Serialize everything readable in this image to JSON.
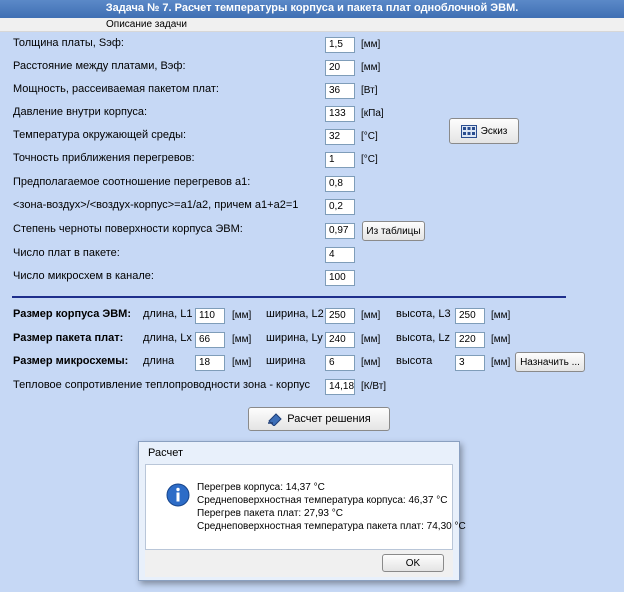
{
  "window": {
    "title": "Задача № 7. Расчет температуры корпуса и пакета плат одноблочной ЭВМ."
  },
  "menu": {
    "items": [
      "Описание задачи"
    ]
  },
  "params": [
    {
      "label": "Толщина платы, Sэф:",
      "value": "1,5",
      "unit": "[мм]"
    },
    {
      "label": "Расстояние между платами, Вэф:",
      "value": "20",
      "unit": "[мм]"
    },
    {
      "label": "Мощность, рассеиваемая пакетом плат:",
      "value": "36",
      "unit": "[Вт]"
    },
    {
      "label": "Давление внутри корпуса:",
      "value": "133",
      "unit": "[кПа]"
    },
    {
      "label": "Температура окружающей среды:",
      "value": "32",
      "unit": "[°С]"
    },
    {
      "label": "Точность приближения перегревов:",
      "value": "1",
      "unit": "[°С]"
    },
    {
      "label": "Предполагаемое соотношение перегревов   а1:",
      "value": "0,8",
      "unit": ""
    },
    {
      "label": "<зона-воздух>/<воздух-корпус>=а1/а2, причем а1+а2=1",
      "value": "0,2",
      "unit": ""
    },
    {
      "label": "Степень черноты поверхности корпуса ЭВМ:",
      "value": "0,97",
      "unit": ""
    },
    {
      "label": "Число плат в пакете:",
      "value": "4",
      "unit": ""
    },
    {
      "label": "Число микросхем в канале:",
      "value": "100",
      "unit": ""
    }
  ],
  "buttons": {
    "sketch": "Эскиз",
    "from_table": "Из таблицы",
    "assign": "Назначить ...",
    "calculate": "Расчет решения"
  },
  "sizes": [
    {
      "title": "Размер корпуса ЭВМ:",
      "l_label": "длина, L1",
      "l": "110",
      "w_label": "ширина, L2",
      "w": "250",
      "h_label": "высота, L3",
      "h": "250",
      "unit": "[мм]"
    },
    {
      "title": "Размер пакета плат:",
      "l_label": "длина, Lx",
      "l": "66",
      "w_label": "ширина, Ly",
      "w": "240",
      "h_label": "высота, Lz",
      "h": "220",
      "unit": "[мм]"
    },
    {
      "title": "Размер микросхемы:",
      "l_label": "длина",
      "l": "18",
      "w_label": "ширина",
      "w": "6",
      "h_label": "высота",
      "h": "3",
      "unit": "[мм]"
    }
  ],
  "thermal": {
    "label": "Тепловое сопротивление теплопроводности зона - корпус",
    "value": "14,18",
    "unit": "[К/Вт]"
  },
  "dialog": {
    "title": "Расчет",
    "lines": [
      "Перегрев корпуса:  14,37 °С",
      "Среднеповерхностная температура корпуса:  46,37 °С",
      "Перегрев пакета плат:  27,93 °С",
      "Среднеповерхностная температура пакета плат:  74,30 °С"
    ],
    "ok": "OK"
  },
  "colors": {
    "title_bg": "#4a7bc0",
    "panel_bg": "#c6d8f5",
    "separator": "#1e2e8c"
  }
}
